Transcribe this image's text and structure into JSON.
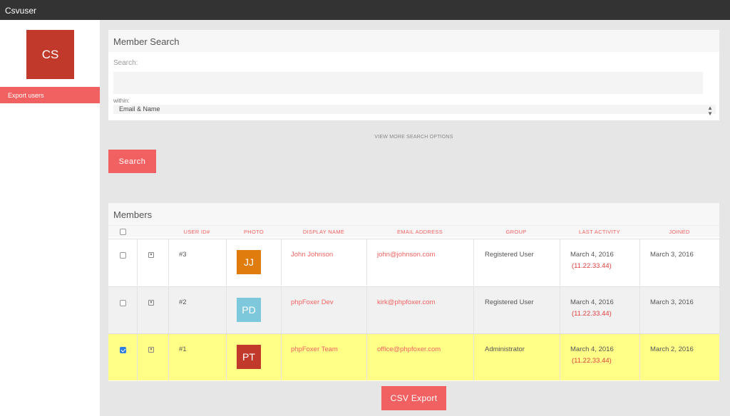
{
  "app": {
    "title": "Csvuser"
  },
  "sidebar": {
    "avatar_initials": "CS",
    "items": [
      {
        "label": "Export users"
      }
    ]
  },
  "search": {
    "title": "Member Search",
    "label": "Search:",
    "value": "",
    "placeholder": "",
    "within_label": "within:",
    "within_value": "Email & Name",
    "more_options": "VIEW MORE SEARCH OPTIONS",
    "button": "Search"
  },
  "members": {
    "title": "Members",
    "columns": [
      "USER ID#",
      "PHOTO",
      "DISPLAY NAME",
      "EMAIL ADDRESS",
      "GROUP",
      "LAST ACTIVITY",
      "JOINED"
    ],
    "rows": [
      {
        "id": "#3",
        "initials": "JJ",
        "photo_color": "#e07b0e",
        "name": "John Johnson",
        "email": "john@johnson.com",
        "group": "Registered User",
        "last_activity": "March 4, 2016",
        "ip": "(11.22.33.44)",
        "joined": "March 3, 2016",
        "checked": false,
        "row_bg": "#ffffff"
      },
      {
        "id": "#2",
        "initials": "PD",
        "photo_color": "#7ec8dc",
        "name": "phpFoxer Dev",
        "email": "kirk@phpfoxer.com",
        "group": "Registered User",
        "last_activity": "March 4, 2016",
        "ip": "(11.22.33.44)",
        "joined": "March 3, 2016",
        "checked": false,
        "row_bg": "#f1f1f1"
      },
      {
        "id": "#1",
        "initials": "PT",
        "photo_color": "#c0392b",
        "name": "phpFoxer Team",
        "email": "office@phpfoxer.com",
        "group": "Administrator",
        "last_activity": "March 4, 2016",
        "ip": "(11.22.33.44)",
        "joined": "March 2, 2016",
        "checked": true,
        "row_bg": "#ffff88"
      }
    ]
  },
  "export": {
    "button": "CSV Export"
  },
  "colors": {
    "accent": "#f26161",
    "topbar": "#333333",
    "selected_row": "#ffff88"
  }
}
